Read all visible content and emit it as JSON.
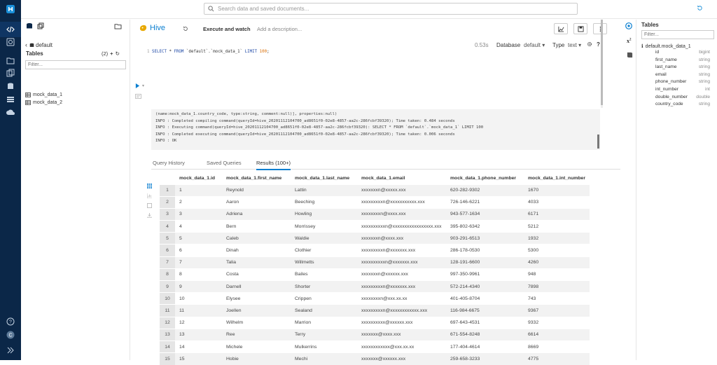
{
  "search": {
    "placeholder": "Search data and saved documents..."
  },
  "assist": {
    "db_name": "default",
    "tables_heading": "Tables",
    "tables_count": "(2)",
    "filter_placeholder": "Filter...",
    "tables": [
      {
        "name": "mock_data_1"
      },
      {
        "name": "mock_data_2"
      }
    ]
  },
  "editor": {
    "app_name": "Hive",
    "execute_label": "Execute and watch",
    "description_placeholder": "Add a description...",
    "time": "0.53s",
    "database_label": "Database",
    "database_value": "default",
    "type_label": "Type",
    "type_value": "text",
    "help": "?",
    "line_number": "1",
    "query": {
      "kw1": "SELECT",
      "star": " * ",
      "kw2": "FROM",
      "table": " `default`.`mock_data_1` ",
      "kw3": "LIMIT",
      "num": " 100",
      "end": ";"
    },
    "log": [
      "(name:mock_data_1.country_code, type:string, comment:null)], properties:null)",
      "INFO  : Completed compiling command(queryId=hive_20201112104700_ad8651f0-02e8-4857-aa2c-286fcbf39320); Time taken: 0.484 seconds",
      "INFO  : Executing command(queryId=hive_20201112104700_ad8651f0-02e8-4857-aa2c-286fcbf39320): SELECT * FROM `default`.`mock_data_1` LIMIT 100",
      "INFO  : Completed executing command(queryId=hive_20201112104700_ad8651f0-02e8-4857-aa2c-286fcbf39320); Time taken: 0.006 seconds",
      "INFO  : OK"
    ],
    "tabs": {
      "history": "Query History",
      "saved": "Saved Queries",
      "results": "Results (100+)"
    }
  },
  "results": {
    "columns": [
      "mock_data_1.id",
      "mock_data_1.first_name",
      "mock_data_1.last_name",
      "mock_data_1.email",
      "mock_data_1.phone_number",
      "mock_data_1.int_number"
    ],
    "rows": [
      [
        "1",
        "1",
        "Reynold",
        "Lattin",
        "xxxxxxxn@xxxxx.xxx",
        "620-282-9302",
        "1670"
      ],
      [
        "2",
        "2",
        "Aaron",
        "Beeching",
        "xxxxxxxxxn@xxxxxxxxxxx.xxx",
        "726-146-6221",
        "4033"
      ],
      [
        "3",
        "3",
        "Adriena",
        "Howling",
        "xxxxxxxxn@xxxx.xxx",
        "943-577-1634",
        "6171"
      ],
      [
        "4",
        "4",
        "Bern",
        "Morrissey",
        "xxxxxxxxxxn@xxxxxxxxxxxxxxxxx.xxx",
        "395-802-6342",
        "5212"
      ],
      [
        "5",
        "5",
        "Caleb",
        "Waldie",
        "xxxxxxxn@xxxx.xxx",
        "903-291-6513",
        "1932"
      ],
      [
        "6",
        "6",
        "Dinah",
        "Clothier",
        "xxxxxxxxxn@xxxxxxx.xxx",
        "286-178-0530",
        "5300"
      ],
      [
        "7",
        "7",
        "Talia",
        "Willmetts",
        "xxxxxxxxxxn@xxxxxxx.xxx",
        "128-191-6600",
        "4260"
      ],
      [
        "8",
        "8",
        "Costa",
        "Bailes",
        "xxxxxxxn@xxxxxx.xxx",
        "997-350-9961",
        "948"
      ],
      [
        "9",
        "9",
        "Darnell",
        "Shorter",
        "xxxxxxxxxn@xxxxxxx.xxx",
        "572-214-4340",
        "7898"
      ],
      [
        "10",
        "10",
        "Elysee",
        "Crippen",
        "xxxxxxxxn@xxx.xx.xx",
        "401-405-8704",
        "743"
      ],
      [
        "11",
        "11",
        "Joellen",
        "Sealand",
        "xxxxxxxxxn@xxxxxxxxxxxx.xxx",
        "116-984-6675",
        "9367"
      ],
      [
        "12",
        "12",
        "Wilhelm",
        "Marrion",
        "xxxxxxxxxx@xxxxxx.xxx",
        "697-643-4531",
        "9332"
      ],
      [
        "13",
        "13",
        "Ree",
        "Terry",
        "xxxxxxx@xxxx.xxx",
        "671-554-8248",
        "6614"
      ],
      [
        "14",
        "14",
        "Michele",
        "Mulkerrins",
        "xxxxxxxxxxxx@xxx.xx.xx",
        "177-404-4614",
        "8669"
      ],
      [
        "15",
        "15",
        "Hobie",
        "Mechi",
        "xxxxxxx@xxxxxx.xxx",
        "259-658-3233",
        "4775"
      ]
    ]
  },
  "right": {
    "heading": "Tables",
    "filter_placeholder": "Filter...",
    "table_name": "default.mock_data_1",
    "columns": [
      {
        "name": "id",
        "type": "bigint"
      },
      {
        "name": "first_name",
        "type": "string"
      },
      {
        "name": "last_name",
        "type": "string"
      },
      {
        "name": "email",
        "type": "string"
      },
      {
        "name": "phone_number",
        "type": "string"
      },
      {
        "name": "int_number",
        "type": "int"
      },
      {
        "name": "double_number",
        "type": "double"
      },
      {
        "name": "country_code",
        "type": "string"
      }
    ]
  },
  "colors": {
    "nav_bg": "#0b2748",
    "accent": "#0b7fd0",
    "keyword": "#1d48a6",
    "number": "#d96b00"
  }
}
